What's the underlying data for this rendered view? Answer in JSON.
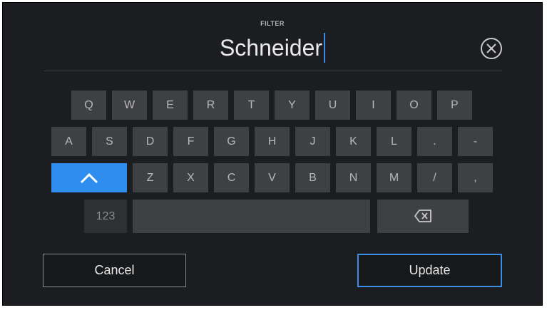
{
  "header": {
    "label": "FILTER",
    "value": "Schneider"
  },
  "keyboard": {
    "row1": [
      "Q",
      "W",
      "E",
      "R",
      "T",
      "Y",
      "U",
      "I",
      "O",
      "P"
    ],
    "row2": [
      "A",
      "S",
      "D",
      "F",
      "G",
      "H",
      "J",
      "K",
      "L",
      ".",
      "-"
    ],
    "row3": [
      "Z",
      "X",
      "C",
      "V",
      "B",
      "N",
      "M",
      "/",
      ","
    ],
    "numbers_label": "123",
    "shift_icon": "chevron-up-icon",
    "backspace_icon": "backspace-icon"
  },
  "actions": {
    "cancel_label": "Cancel",
    "update_label": "Update"
  },
  "colors": {
    "accent": "#2f8df0",
    "background": "#1c1d20",
    "key": "#3e4044"
  }
}
